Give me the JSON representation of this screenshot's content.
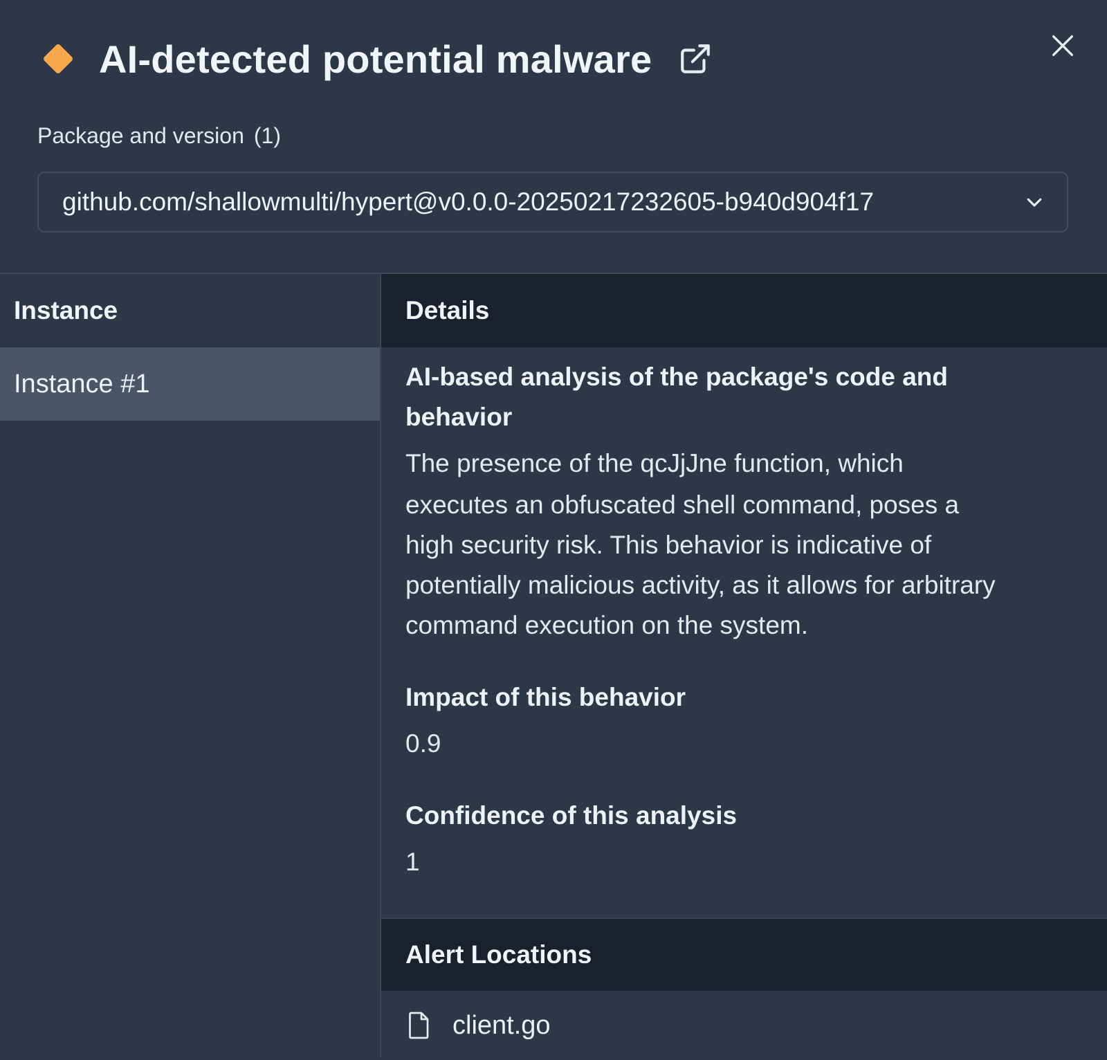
{
  "header": {
    "title": "AI-detected potential malware",
    "severity_icon": "diamond-icon",
    "severity_color": "#f6a84b",
    "external_link_icon": "external-link-icon",
    "close_icon": "close-icon"
  },
  "package": {
    "label": "Package and version",
    "count": "(1)",
    "selected": "github.com/shallowmulti/hypert@v0.0.0-20250217232605-b940d904f17",
    "chevron_icon": "chevron-down-icon"
  },
  "instances": {
    "header": "Instance",
    "items": [
      {
        "label": "Instance #1",
        "selected": true
      }
    ]
  },
  "details": {
    "header": "Details",
    "analysis_title_line1": "AI-based analysis of the package's code and",
    "analysis_title_line2": "behavior",
    "analysis_lines": [
      "The presence of the qcJjJne function, which",
      "executes an obfuscated shell command, poses a",
      "high security risk. This behavior is indicative of",
      "potentially malicious activity, as it allows for arbitrary",
      "command execution on the system."
    ],
    "impact_title": "Impact of this behavior",
    "impact_value": "0.9",
    "confidence_title": "Confidence of this analysis",
    "confidence_value": "1"
  },
  "alert_locations": {
    "header": "Alert Locations",
    "files": [
      {
        "name": "client.go",
        "icon": "file-icon"
      }
    ]
  },
  "colors": {
    "background": "#2d3748",
    "header_dark": "#1a202c",
    "selected_row": "#4a5568",
    "accent_orange": "#f6a84b"
  }
}
